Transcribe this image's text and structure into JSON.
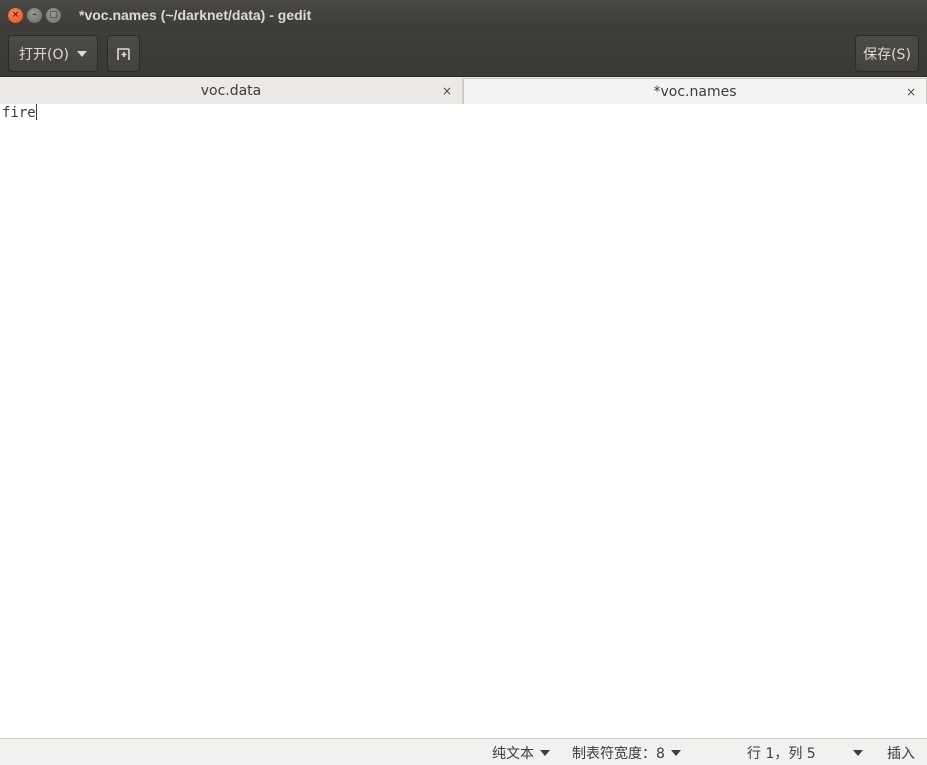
{
  "window": {
    "title": "*voc.names (~/darknet/data) - gedit",
    "buttons": {
      "close": "×",
      "minimize": "–",
      "maximize": "□"
    }
  },
  "header": {
    "open_label": "打开(O)",
    "save_label": "保存(S)",
    "new_tab_icon": "new-document-icon"
  },
  "tabs": [
    {
      "label": "voc.data",
      "close": "×",
      "active": false
    },
    {
      "label": "*voc.names",
      "close": "×",
      "active": true
    }
  ],
  "editor": {
    "content": "fire"
  },
  "statusbar": {
    "language": "纯文本",
    "tab_width": "制表符宽度：8",
    "position": "行 1，列 5",
    "mode": "插入"
  }
}
